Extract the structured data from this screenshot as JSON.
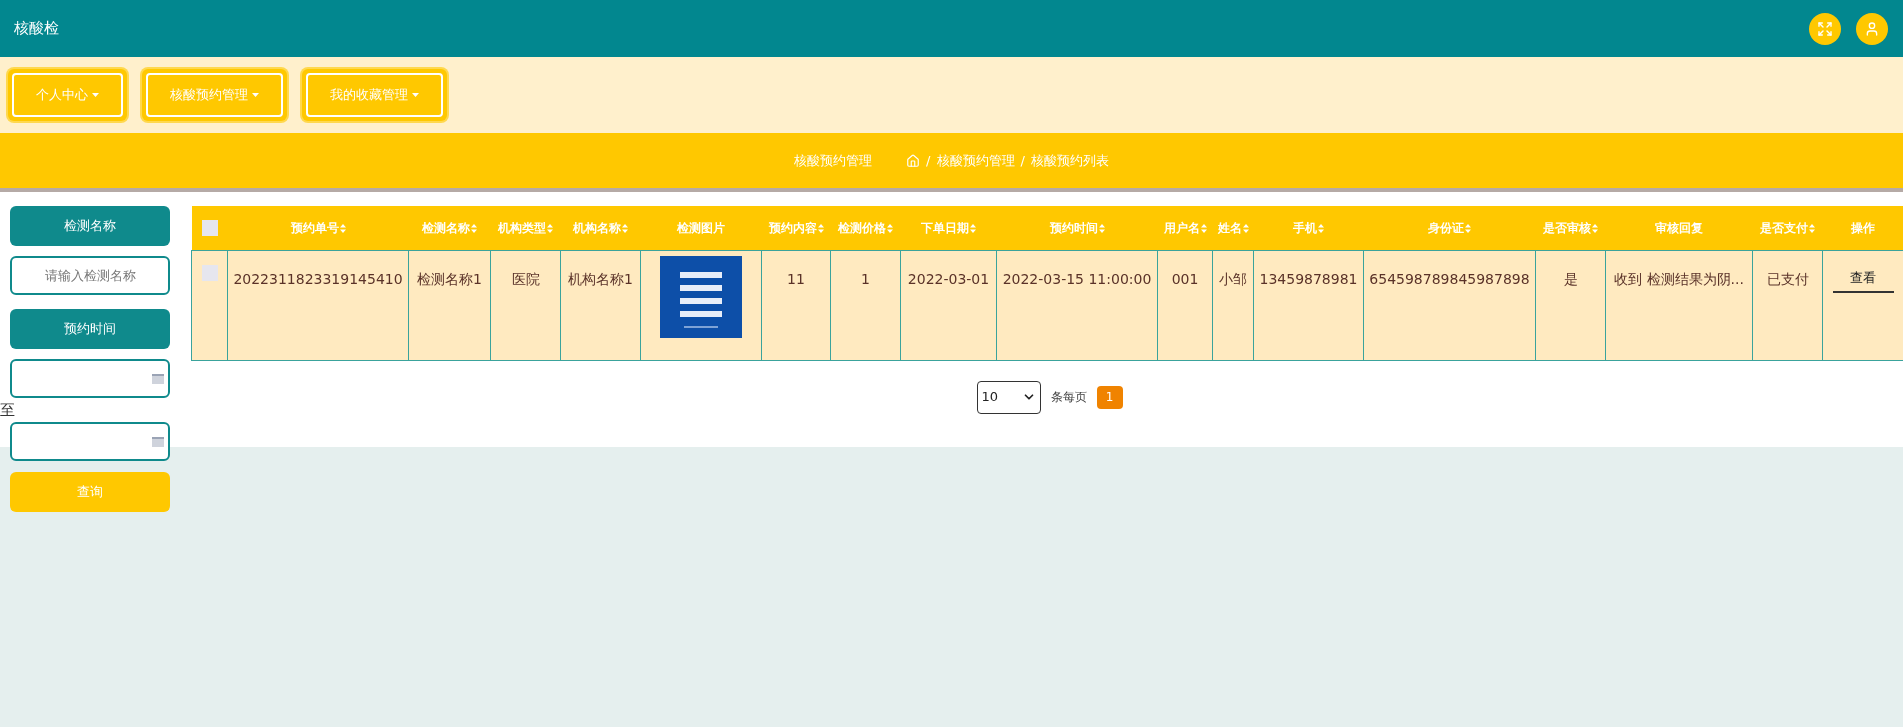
{
  "header": {
    "title": "核酸检"
  },
  "nav": [
    {
      "label": "个人中心"
    },
    {
      "label": "核酸预约管理"
    },
    {
      "label": "我的收藏管理"
    }
  ],
  "breadcrumb": {
    "title": "核酸预约管理",
    "separator": "/",
    "path": [
      "核酸预约管理",
      "核酸预约列表"
    ]
  },
  "filters": {
    "name_label": "检测名称",
    "name_placeholder": "请输入检测名称",
    "time_label": "预约时间",
    "range_separator": "至",
    "search_button": "查询"
  },
  "table": {
    "select_all_checked": false,
    "columns": [
      {
        "label": "预约单号",
        "sortable": true
      },
      {
        "label": "检测名称",
        "sortable": true
      },
      {
        "label": "机构类型",
        "sortable": true
      },
      {
        "label": "机构名称",
        "sortable": true
      },
      {
        "label": "检测图片",
        "sortable": false
      },
      {
        "label": "预约内容",
        "sortable": true
      },
      {
        "label": "检测价格",
        "sortable": true
      },
      {
        "label": "下单日期",
        "sortable": true
      },
      {
        "label": "预约时间",
        "sortable": true
      },
      {
        "label": "用户名",
        "sortable": true
      },
      {
        "label": "姓名",
        "sortable": true
      },
      {
        "label": "手机",
        "sortable": true
      },
      {
        "label": "身份证",
        "sortable": true
      },
      {
        "label": "是否审核",
        "sortable": true
      },
      {
        "label": "审核回复",
        "sortable": false
      },
      {
        "label": "是否支付",
        "sortable": true
      },
      {
        "label": "操作",
        "sortable": false
      }
    ],
    "rows": [
      {
        "checked": false,
        "cells": [
          {
            "kind": "text",
            "text": "2022311823319145410"
          },
          {
            "kind": "text",
            "text": "检测名称1"
          },
          {
            "kind": "text",
            "text": "医院"
          },
          {
            "kind": "text",
            "text": "机构名称1"
          },
          {
            "kind": "picture"
          },
          {
            "kind": "text",
            "text": "11"
          },
          {
            "kind": "text",
            "text": "1"
          },
          {
            "kind": "text",
            "text": "2022-03-01"
          },
          {
            "kind": "text",
            "text": "2022-03-15 11:00:00"
          },
          {
            "kind": "text",
            "text": "001"
          },
          {
            "kind": "text",
            "text": "小邹"
          },
          {
            "kind": "text",
            "text": "13459878981"
          },
          {
            "kind": "text",
            "text": "654598789845987898"
          },
          {
            "kind": "text",
            "text": "是"
          },
          {
            "kind": "text",
            "text": "收到 检测结果为阴..."
          },
          {
            "kind": "text",
            "text": "已支付"
          },
          {
            "kind": "button",
            "text": "查看"
          }
        ]
      }
    ]
  },
  "pagination": {
    "page_size": "10",
    "page_size_suffix": "条每页",
    "pages": [
      {
        "label": "1",
        "selected": true
      }
    ]
  }
}
